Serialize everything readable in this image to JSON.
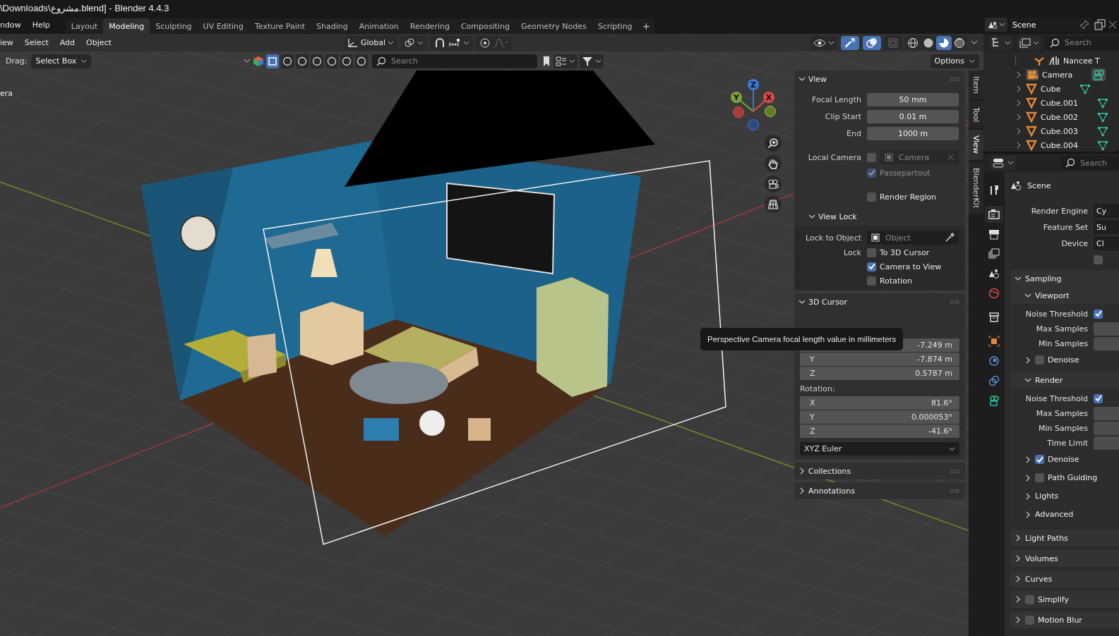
{
  "title_bar": {
    "title": "\\Downloads\\مشروع.blend] - Blender 4.4.3"
  },
  "menu": [
    "ndow",
    "Help"
  ],
  "workspaces": [
    {
      "label": "Layout",
      "selected": false
    },
    {
      "label": "Modeling",
      "selected": true
    },
    {
      "label": "Sculpting",
      "selected": false
    },
    {
      "label": "UV Editing",
      "selected": false
    },
    {
      "label": "Texture Paint",
      "selected": false
    },
    {
      "label": "Shading",
      "selected": false
    },
    {
      "label": "Animation",
      "selected": false
    },
    {
      "label": "Rendering",
      "selected": false
    },
    {
      "label": "Compositing",
      "selected": false
    },
    {
      "label": "Geometry Nodes",
      "selected": false
    },
    {
      "label": "Scripting",
      "selected": false
    }
  ],
  "add_workspace": "+",
  "scene_selector": {
    "value": "Scene"
  },
  "viewport_header": {
    "menus": [
      "iew",
      "Select",
      "Add",
      "Object"
    ],
    "orientation": "Global",
    "toggles": [
      {
        "kind": "gizmos",
        "on": true
      },
      {
        "kind": "overlays",
        "on": true
      },
      {
        "kind": "xray",
        "on": false
      }
    ],
    "shading_modes": [
      {
        "kind": "wireframe",
        "selected": false
      },
      {
        "kind": "solid",
        "selected": false
      },
      {
        "kind": "material",
        "selected": true
      },
      {
        "kind": "rendered",
        "selected": false
      }
    ]
  },
  "tool_settings": {
    "drag_label": "Drag:",
    "drag_value": "Select Box",
    "filter_toggles": [
      {
        "on": true
      },
      {
        "on": false
      },
      {
        "on": false
      },
      {
        "on": false
      },
      {
        "on": false
      },
      {
        "on": false
      },
      {
        "on": false
      }
    ],
    "search_placeholder": "Search",
    "options": "Options"
  },
  "viewport": {
    "object_label": "era",
    "gizmo_axes": [
      {
        "label": "Z",
        "color": "#3c78d8"
      },
      {
        "label": "Y",
        "color": "#7aa33a"
      },
      {
        "label": "X",
        "color": "#e04848"
      }
    ]
  },
  "tooltip": {
    "text": "Perspective Camera focal length value in millimeters"
  },
  "sidebar_tabs": [
    {
      "label": "Item",
      "selected": false
    },
    {
      "label": "Tool",
      "selected": false
    },
    {
      "label": "View",
      "selected": true
    },
    {
      "label": "BlenderKit",
      "selected": false
    }
  ],
  "view_panel": {
    "title": "View",
    "expanded": true,
    "fields": [
      {
        "label": "Focal Length",
        "value": "50 mm"
      },
      {
        "label": "Clip Start",
        "value": "0.01 m"
      },
      {
        "label": "End",
        "value": "1000 m"
      }
    ],
    "local_camera": {
      "label": "Local Camera",
      "checked": false,
      "placeholder": "Camera"
    },
    "passepartout": {
      "label": "Passepartout",
      "checked": true
    },
    "render_region": {
      "label": "Render Region",
      "checked": false
    },
    "view_lock": {
      "title": "View Lock",
      "expanded": true,
      "lock_to_object": {
        "label": "Lock to Object",
        "placeholder": "Object"
      },
      "lock_label": "Lock",
      "options": [
        {
          "label": "To 3D Cursor",
          "checked": false
        },
        {
          "label": "Camera to View",
          "checked": true
        },
        {
          "label": "Rotation",
          "checked": false
        }
      ]
    }
  },
  "cursor_panel": {
    "title": "3D Cursor",
    "expanded": true,
    "location": [
      {
        "value": "-7.249 m"
      },
      {
        "axis": "Y",
        "value": "-7.874 m"
      },
      {
        "axis": "Z",
        "value": "0.5787 m"
      }
    ],
    "rotation_label": "Rotation:",
    "rotation": [
      {
        "axis": "X",
        "value": "81.6°"
      },
      {
        "axis": "Y",
        "value": "0.000053°"
      },
      {
        "axis": "Z",
        "value": "-41.6°"
      }
    ],
    "rotation_mode": "XYZ Euler"
  },
  "collapsed_panels": [
    {
      "title": "Collections",
      "expanded": false
    },
    {
      "title": "Annotations",
      "expanded": false
    }
  ],
  "outliner": {
    "search_placeholder": "Search",
    "items": [
      {
        "name": "Nancee T",
        "kind": "armature"
      },
      {
        "name": "Camera",
        "kind": "camera"
      },
      {
        "name": "Cube",
        "kind": "mesh"
      },
      {
        "name": "Cube.001",
        "kind": "mesh"
      },
      {
        "name": "Cube.002",
        "kind": "mesh"
      },
      {
        "name": "Cube.003",
        "kind": "mesh"
      },
      {
        "name": "Cube.004",
        "kind": "mesh"
      }
    ]
  },
  "properties": {
    "search_placeholder": "Search",
    "tabs": [
      {
        "kind": "tool",
        "selected": false
      },
      {
        "kind": "render",
        "selected": true
      },
      {
        "kind": "output",
        "selected": false
      },
      {
        "kind": "view_layer",
        "selected": false
      },
      {
        "kind": "scene",
        "selected": false
      },
      {
        "kind": "world",
        "selected": false
      },
      {
        "kind": "collection",
        "selected": false
      },
      {
        "kind": "object",
        "selected": false
      },
      {
        "kind": "physics",
        "selected": false
      },
      {
        "kind": "constraints",
        "selected": false
      },
      {
        "kind": "camera_data",
        "selected": false
      }
    ],
    "context": "Scene",
    "fields": [
      {
        "label": "Render Engine",
        "value": "Cy"
      },
      {
        "label": "Feature Set",
        "value": "Su"
      },
      {
        "label": "Device",
        "value": "Cl"
      }
    ],
    "extra_checkbox": {
      "checked": false
    },
    "sections": [
      {
        "label": "Sampling",
        "expanded": true,
        "children": [
          {
            "label": "Viewport",
            "expanded": true,
            "rows": [
              {
                "kind": "check",
                "label": "Noise Threshold",
                "checked": true
              },
              {
                "kind": "field",
                "label": "Max Samples"
              },
              {
                "kind": "field",
                "label": "Min Samples"
              }
            ],
            "children": [
              {
                "label": "Denoise",
                "checked": false
              }
            ]
          },
          {
            "label": "Render",
            "expanded": true,
            "rows": [
              {
                "kind": "check",
                "label": "Noise Threshold",
                "checked": true
              },
              {
                "kind": "field",
                "label": "Max Samples"
              },
              {
                "kind": "field",
                "label": "Min Samples"
              },
              {
                "kind": "field",
                "label": "Time Limit"
              }
            ],
            "children": [
              {
                "label": "Denoise",
                "checked": true
              },
              {
                "label": "Path Guiding",
                "checked": false
              },
              {
                "label": "Lights"
              },
              {
                "label": "Advanced"
              }
            ]
          }
        ]
      },
      {
        "label": "Light Paths",
        "expanded": false
      },
      {
        "label": "Volumes",
        "expanded": false
      },
      {
        "label": "Curves",
        "expanded": false
      },
      {
        "label": "Simplify",
        "expanded": false,
        "checked": false
      },
      {
        "label": "Motion Blur",
        "expanded": false,
        "checked": false
      }
    ]
  }
}
